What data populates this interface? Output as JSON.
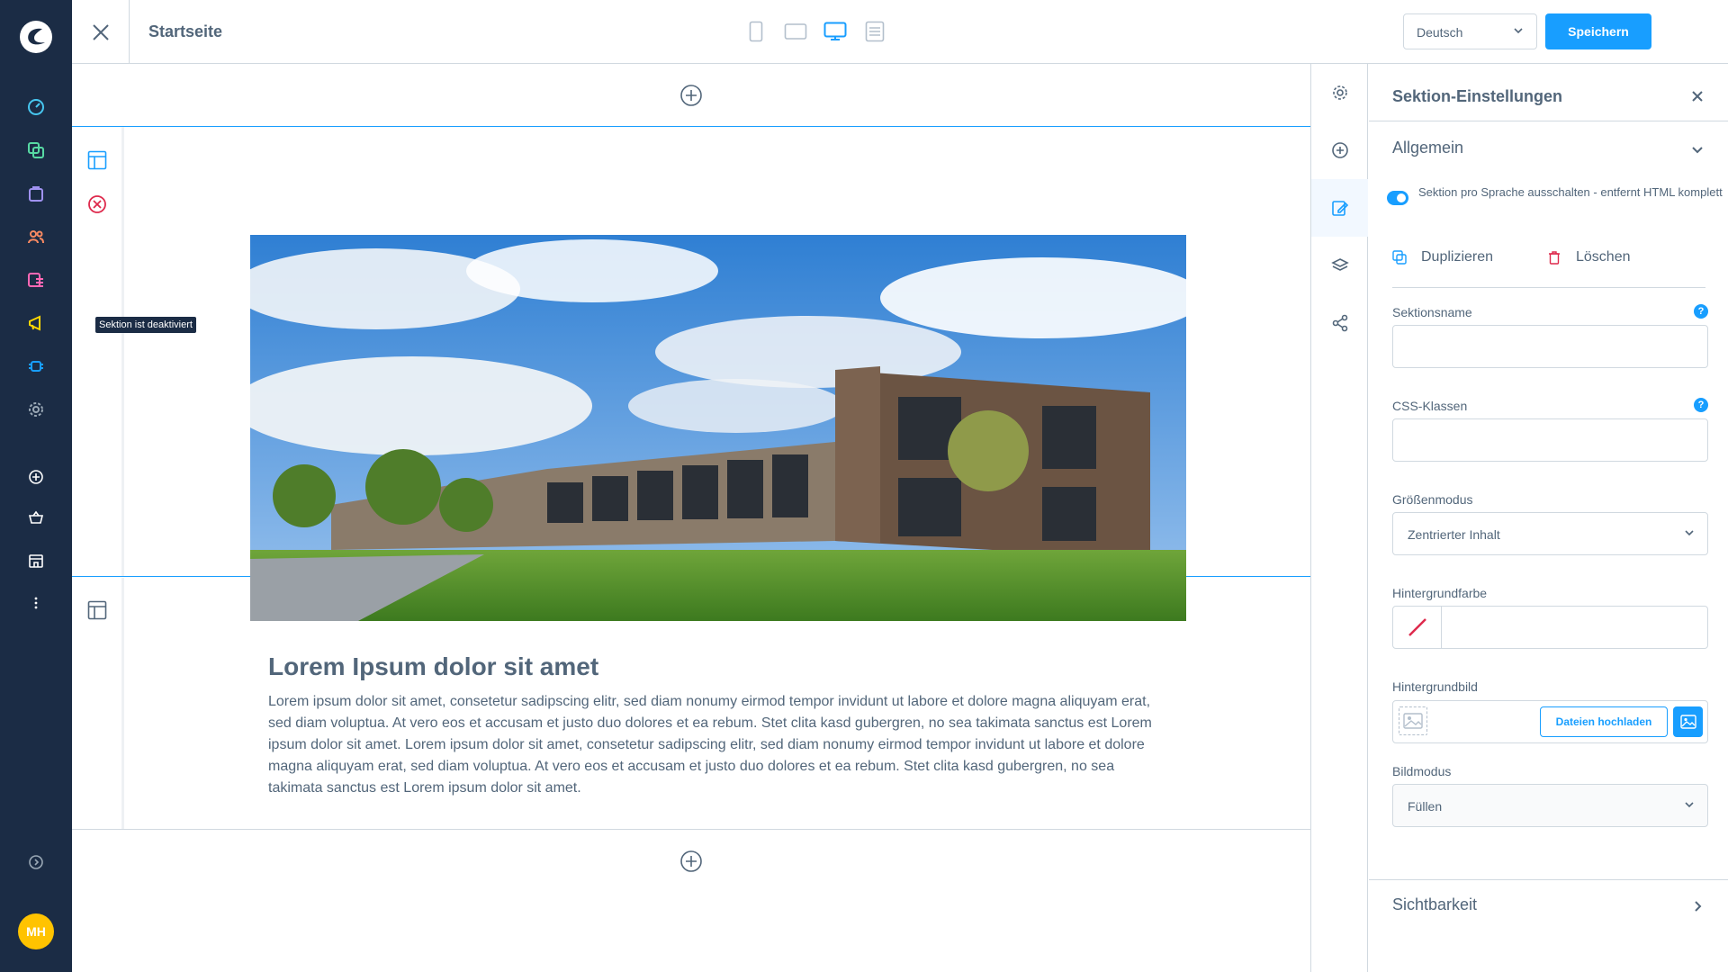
{
  "topbar": {
    "page_title": "Startseite",
    "language": "Deutsch",
    "save_label": "Speichern"
  },
  "canvas": {
    "tooltip": "Sektion ist deaktiviert",
    "heading": "Lorem Ipsum dolor sit amet",
    "paragraph": "Lorem ipsum dolor sit amet, consetetur sadipscing elitr, sed diam nonumy eirmod tempor invidunt ut labore et dolore magna aliquyam erat, sed diam voluptua. At vero eos et accusam et justo duo dolores et ea rebum. Stet clita kasd gubergren, no sea takimata sanctus est Lorem ipsum dolor sit amet. Lorem ipsum dolor sit amet, consetetur sadipscing elitr, sed diam nonumy eirmod tempor invidunt ut labore et dolore magna aliquyam erat, sed diam voluptua. At vero eos et accusam et justo duo dolores et ea rebum. Stet clita kasd gubergren, no sea takimata sanctus est Lorem ipsum dolor sit amet."
  },
  "panel": {
    "title": "Sektion-Einstellungen",
    "general_title": "Allgemein",
    "toggle_label": "Sektion pro Sprache ausschalten - entfernt HTML komplett",
    "duplicate_label": "Duplizieren",
    "delete_label": "Löschen",
    "section_name_label": "Sektionsname",
    "css_classes_label": "CSS-Klassen",
    "size_mode_label": "Größenmodus",
    "size_mode_value": "Zentrierter Inhalt",
    "bg_color_label": "Hintergrundfarbe",
    "bg_image_label": "Hintergrundbild",
    "upload_label": "Dateien hochladen",
    "image_mode_label": "Bildmodus",
    "image_mode_value": "Füllen",
    "visibility_title": "Sichtbarkeit",
    "help_glyph": "?"
  },
  "user": {
    "initials": "MH"
  },
  "colors": {
    "accent": "#189eff",
    "nav_bg": "#1b2c45",
    "text": "#52667a",
    "danger": "#de294c"
  }
}
